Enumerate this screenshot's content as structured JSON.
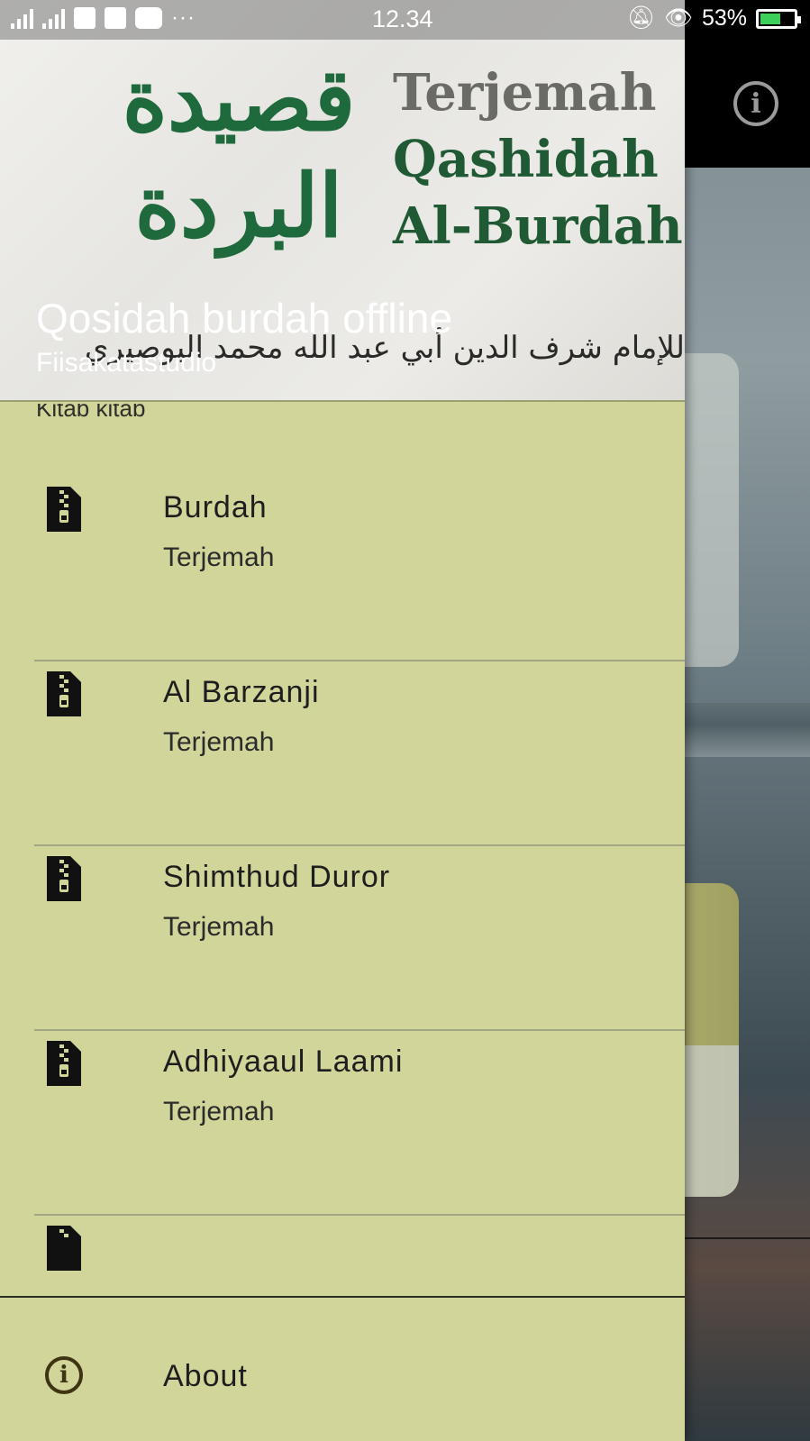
{
  "status_bar": {
    "time": "12.34",
    "battery": "53%",
    "icons": [
      "signal-icon",
      "signal-icon",
      "sim-icon",
      "mail-icon",
      "youtube-icon",
      "more-dots-icon",
      "mute-icon",
      "eye-icon",
      "battery-icon"
    ]
  },
  "drawer": {
    "header": {
      "banner_arabic": "قصيدة البردة",
      "banner_latin": [
        "Terjemah",
        "Qashidah",
        "Al-Burdah"
      ],
      "banner_arabic_sub": "للإمام شرف الدين أبي عبد الله محمد البوصيري",
      "app_name": "Qosidah burdah offline",
      "developer": "Fiisakatastudio"
    },
    "section_label": "Kitab kitab",
    "items": [
      {
        "title": "Burdah",
        "subtitle": "Terjemah",
        "icon": "zip-file-icon"
      },
      {
        "title": "Al Barzanji",
        "subtitle": "Terjemah",
        "icon": "zip-file-icon"
      },
      {
        "title": "Shimthud Duror",
        "subtitle": "Terjemah",
        "icon": "zip-file-icon"
      },
      {
        "title": "Adhiyaaul Laami",
        "subtitle": "Terjemah",
        "icon": "zip-file-icon"
      }
    ],
    "footer": {
      "label": "About",
      "icon": "info-icon"
    }
  },
  "background": {
    "info_icon": "info-icon"
  },
  "colors": {
    "drawer_bg": "#d1d59a",
    "header_green": "#1f6a3c",
    "separator": "#a2a682"
  }
}
